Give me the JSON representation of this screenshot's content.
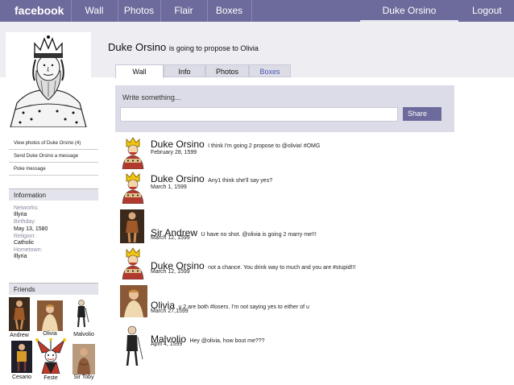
{
  "topbar": {
    "logo": "facebook",
    "nav": [
      "Wall",
      "Photos",
      "Flair",
      "Boxes"
    ],
    "user": "Duke Orsino",
    "logout": "Logout"
  },
  "profile": {
    "name": "Duke Orsino",
    "status": "is going to propose to Olivia",
    "links": [
      "View photos of Duke Orsino (4)",
      "Send Duke Orsino a message",
      "Poke message"
    ]
  },
  "info": {
    "heading": "Information",
    "rows": [
      {
        "label": "Networks:",
        "value": "Illyria"
      },
      {
        "label": "Birthday:",
        "value": "May 13, 1580"
      },
      {
        "label": "Religion:",
        "value": "Catholic"
      },
      {
        "label": "Hometown:",
        "value": "Illyria"
      }
    ]
  },
  "friends": {
    "heading": "Friends",
    "list": [
      "Andrew",
      "Olivia",
      "Malvolio",
      "Cesario",
      "Feste",
      "Sir Toby"
    ]
  },
  "tabs": [
    "Wall",
    "Info",
    "Photos",
    "Boxes"
  ],
  "composer": {
    "prompt": "Write something...",
    "share": "Share"
  },
  "posts": [
    {
      "author": "Duke Orsino",
      "message": "I think I'm going 2 propose to @olivia! #OMG",
      "date": "February 28, 1599"
    },
    {
      "author": "Duke Orsino",
      "message": "Any1 think she'll say yes?",
      "date": "March 1, 1599"
    },
    {
      "author": "Sir Andrew",
      "message": "U have no shot. @olivia is going 2 marry me!!!",
      "date": "March 12, 1599"
    },
    {
      "author": "Duke Orsino",
      "message": "not a chance. You drink way to much and you are #stupid!!!",
      "date": "March 12, 1599"
    },
    {
      "author": "Olivia",
      "message": "u 2 are both #losers. I'm not saying yes to either of u",
      "date": "March 27,1599"
    },
    {
      "author": "Malvolio",
      "message": "Hey @olivia, how bout me???",
      "date": "April 4, 1599"
    }
  ],
  "colors": {
    "topbar": "#6d6a9c",
    "accent": "#4a57b0",
    "panel": "#dcdce8"
  }
}
